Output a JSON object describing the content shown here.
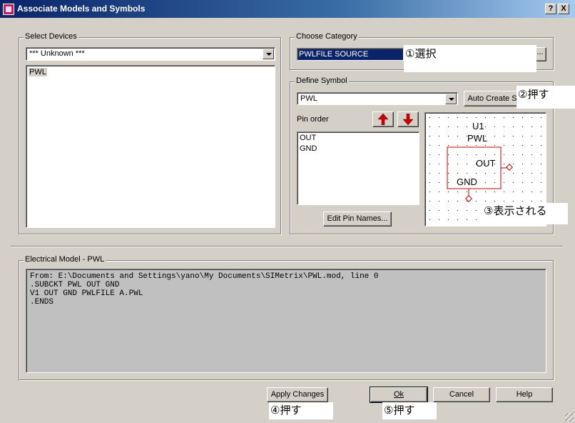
{
  "window": {
    "title": "Associate Models and Symbols",
    "help_btn": "?",
    "close_btn": "X"
  },
  "select_devices": {
    "label": "Select Devices",
    "combo_value": "*** Unknown ***",
    "list_items": [
      "PWL"
    ]
  },
  "choose_category": {
    "label": "Choose Category",
    "value": "PWLFILE SOURCE",
    "browse_label": "..."
  },
  "define_symbol": {
    "label": "Define Symbol",
    "combo_value": "PWL",
    "auto_create_label": "Auto Create S",
    "pin_order_label": "Pin order",
    "pins": [
      "OUT",
      "GND"
    ],
    "edit_pin_names_label": "Edit Pin Names...",
    "preview": {
      "ref": "U1",
      "name": "PWL",
      "pin_out": "OUT",
      "pin_gnd": "GND",
      "symbol_color": "#cc0000"
    }
  },
  "electrical_model": {
    "label": "Electrical Model - PWL",
    "lines": [
      "From: E:\\Documents and Settings\\yano\\My Documents\\SIMetrix\\PWL.mod, line 0",
      ".SUBCKT PWL OUT GND",
      "V1 OUT GND PWLFILE A.PWL",
      ".ENDS"
    ]
  },
  "buttons": {
    "apply_changes": "Apply Changes",
    "ok": "Ok",
    "cancel": "Cancel",
    "help": "Help"
  },
  "annotations": {
    "n1": "①選択",
    "n2": "②押す",
    "n3": "③表示される",
    "n4": "④押す",
    "n5": "⑤押す"
  }
}
